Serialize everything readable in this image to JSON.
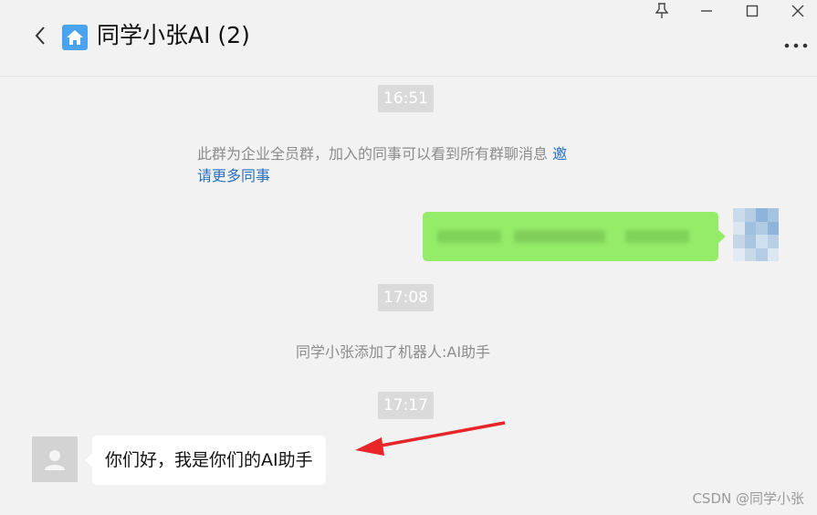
{
  "header": {
    "title": "同学小张AI (2)"
  },
  "window_controls": [
    "pin",
    "minimize",
    "maximize",
    "close"
  ],
  "messages": {
    "time_1": "16:51",
    "system_1_text": "此群为企业全员群，加入的同事可以看到所有群聊消息",
    "system_1_invite_a": "邀",
    "system_1_invite_b": "请更多同事",
    "time_2": "17:08",
    "system_2_text": "同学小张添加了机器人:AI助手",
    "time_3": "17:17",
    "bot_message": "你们好，我是你们的AI助手"
  },
  "watermark": "CSDN @同学小张",
  "colors": {
    "background": "#f2f2f2",
    "self_bubble": "#95ec69",
    "other_bubble": "#ffffff",
    "link": "#2a6fbd",
    "annotation_arrow": "#e8262a"
  },
  "icons": {
    "back": "chevron-left-icon",
    "group": "home-icon",
    "pin": "pin-icon",
    "minimize": "minimize-icon",
    "maximize": "maximize-icon",
    "close": "close-icon",
    "more": "more-icon",
    "bot_avatar": "person-icon"
  }
}
